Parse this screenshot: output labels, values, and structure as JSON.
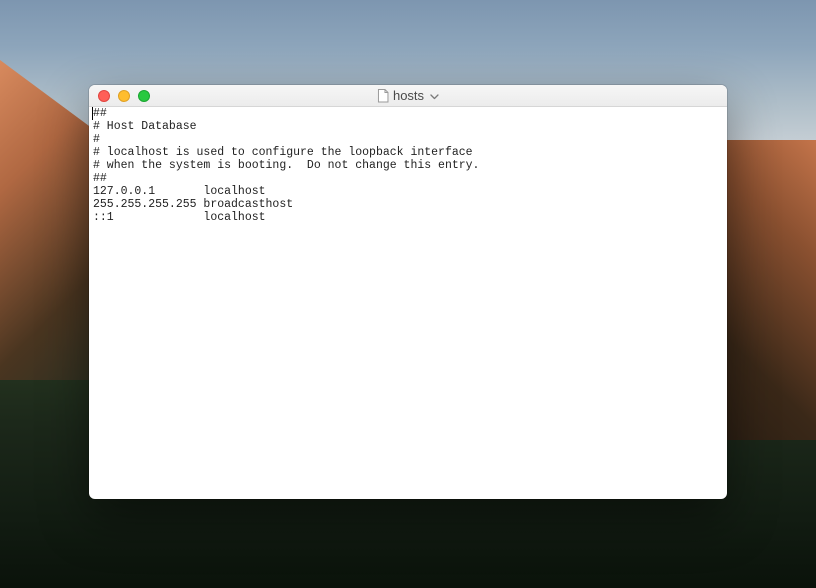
{
  "window": {
    "title": "hosts"
  },
  "editor": {
    "content": "##\n# Host Database\n#\n# localhost is used to configure the loopback interface\n# when the system is booting.  Do not change this entry.\n##\n127.0.0.1       localhost\n255.255.255.255 broadcasthost\n::1             localhost"
  }
}
